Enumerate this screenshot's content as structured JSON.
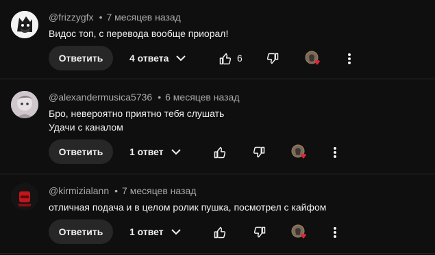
{
  "comments": [
    {
      "author": "@frizzygfx",
      "time": "7 месяцев назад",
      "lines": [
        "Видос топ, с перевода вообще приорал!"
      ],
      "reply_label": "Ответить",
      "replies_label": "4 ответа",
      "likes": "6"
    },
    {
      "author": "@alexandermusica5736",
      "time": "6 месяцев назад",
      "lines": [
        "Бро, невероятно приятно тебя слушать",
        "Удачи с каналом"
      ],
      "reply_label": "Ответить",
      "replies_label": "1 ответ",
      "likes": ""
    },
    {
      "author": "@kirmizialann",
      "time": "7 месяцев назад",
      "lines": [
        "отличная подача и в целом ролик пушка, посмотрел с кайфом"
      ],
      "reply_label": "Ответить",
      "replies_label": "1 ответ",
      "likes": ""
    }
  ],
  "separator": "•",
  "icons": {
    "like": "thumb-up-icon",
    "dislike": "thumb-down-icon",
    "creator_heart": "creator-heart-icon",
    "more": "more-vert-icon",
    "expand": "chevron-down-icon"
  },
  "colors": {
    "background": "#0f0f0f",
    "button": "#272727",
    "heart": "#e8223e",
    "muted": "#aaaaaa"
  }
}
